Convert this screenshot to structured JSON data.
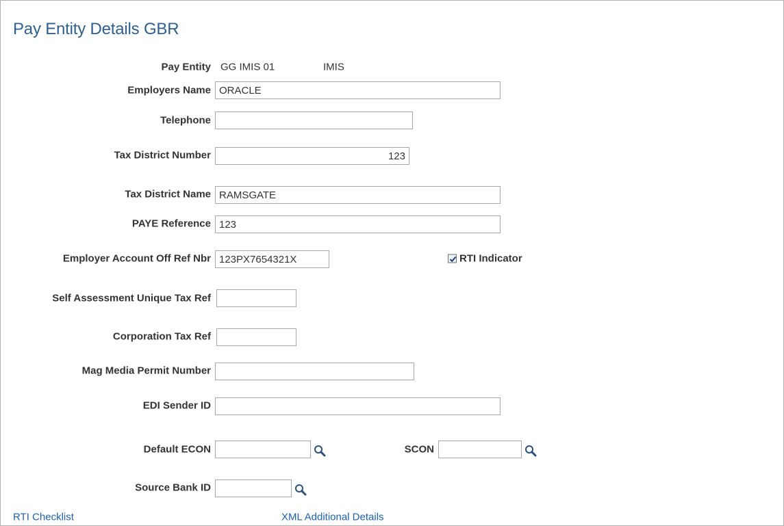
{
  "page": {
    "title": "Pay Entity Details GBR"
  },
  "pay_entity": {
    "label": "Pay Entity",
    "code": "GG IMIS 01",
    "description": "IMIS"
  },
  "fields": {
    "employers_name": {
      "label": "Employers Name",
      "value": "ORACLE"
    },
    "telephone": {
      "label": "Telephone",
      "value": ""
    },
    "tax_district_number": {
      "label": "Tax District Number",
      "value": "123"
    },
    "tax_district_name": {
      "label": "Tax District Name",
      "value": "RAMSGATE"
    },
    "paye_reference": {
      "label": "PAYE Reference",
      "value": "123"
    },
    "employer_account_off_ref": {
      "label": "Employer Account Off Ref Nbr",
      "value": "123PX7654321X"
    },
    "self_assessment_utr": {
      "label": "Self Assessment Unique Tax Ref",
      "value": ""
    },
    "corporation_tax_ref": {
      "label": "Corporation Tax Ref",
      "value": ""
    },
    "mag_media_permit": {
      "label": "Mag Media Permit Number",
      "value": ""
    },
    "edi_sender_id": {
      "label": "EDI Sender ID",
      "value": ""
    },
    "default_econ": {
      "label": "Default ECON",
      "value": ""
    },
    "scon": {
      "label": "SCON",
      "value": ""
    },
    "source_bank_id": {
      "label": "Source Bank ID",
      "value": ""
    }
  },
  "rti_indicator": {
    "label": "RTI Indicator",
    "checked": true
  },
  "links": {
    "rti_checklist": "RTI Checklist",
    "xml_additional_details": "XML Additional Details"
  },
  "icons": {
    "lookup": "magnifier-lookup-icon",
    "checkbox": "checkmark-icon"
  },
  "colors": {
    "title": "#2f5f8f",
    "link": "#1f5ea8",
    "label": "#333333",
    "border": "#a7a7a7"
  }
}
